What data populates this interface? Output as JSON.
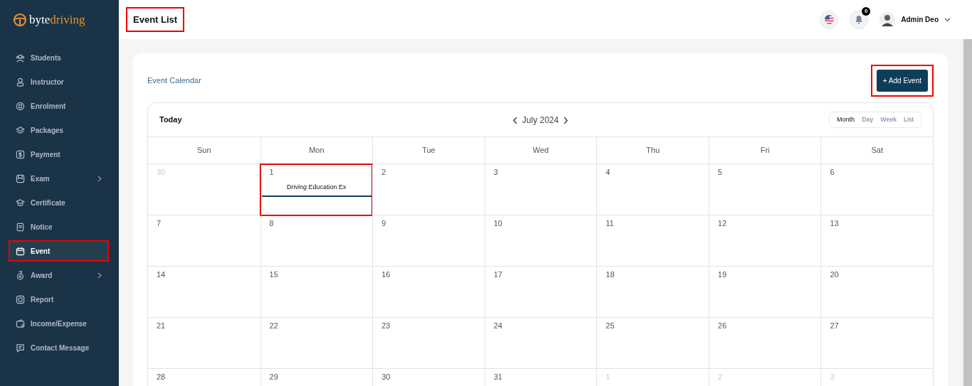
{
  "brand": {
    "part_1": "byte",
    "part_2": "driving"
  },
  "sidebar": {
    "items": [
      {
        "label": "Students",
        "has_submenu": false,
        "selected": false,
        "highlighted": false
      },
      {
        "label": "Instructor",
        "has_submenu": false,
        "selected": false,
        "highlighted": false
      },
      {
        "label": "Enrolment",
        "has_submenu": false,
        "selected": false,
        "highlighted": false
      },
      {
        "label": "Packages",
        "has_submenu": false,
        "selected": false,
        "highlighted": false
      },
      {
        "label": "Payment",
        "has_submenu": false,
        "selected": false,
        "highlighted": false
      },
      {
        "label": "Exam",
        "has_submenu": true,
        "selected": false,
        "highlighted": false
      },
      {
        "label": "Certificate",
        "has_submenu": false,
        "selected": false,
        "highlighted": false
      },
      {
        "label": "Notice",
        "has_submenu": false,
        "selected": false,
        "highlighted": false
      },
      {
        "label": "Event",
        "has_submenu": false,
        "selected": true,
        "highlighted": true
      },
      {
        "label": "Award",
        "has_submenu": true,
        "selected": false,
        "highlighted": false
      },
      {
        "label": "Report",
        "has_submenu": false,
        "selected": false,
        "highlighted": false
      },
      {
        "label": "Income/Expense",
        "has_submenu": false,
        "selected": false,
        "highlighted": false
      },
      {
        "label": "Contact Message",
        "has_submenu": false,
        "selected": false,
        "highlighted": false
      }
    ]
  },
  "header": {
    "title": "Event List",
    "title_highlighted": true,
    "notification_count": "0",
    "user_name": "Admin Deo"
  },
  "panel": {
    "title": "Event Calendar",
    "add_button": {
      "label": "+ Add Event",
      "highlighted": true
    }
  },
  "calendar": {
    "today_button": "Today",
    "month_label": "July 2024",
    "views": [
      {
        "label": "Month",
        "selected": true
      },
      {
        "label": "Day",
        "selected": false
      },
      {
        "label": "Week",
        "selected": false
      },
      {
        "label": "List",
        "selected": false
      }
    ],
    "weekdays": [
      "Sun",
      "Mon",
      "Tue",
      "Wed",
      "Thu",
      "Fri",
      "Sat"
    ],
    "weeks": [
      {
        "days": [
          {
            "label": "30",
            "outside": true
          },
          {
            "label": "1",
            "outside": false,
            "events": [
              {
                "title": "Driving Education Ex",
                "highlighted": true
              }
            ]
          },
          {
            "label": "2",
            "outside": false
          },
          {
            "label": "3",
            "outside": false
          },
          {
            "label": "4",
            "outside": false
          },
          {
            "label": "5",
            "outside": false
          },
          {
            "label": "6",
            "outside": false
          }
        ]
      },
      {
        "days": [
          {
            "label": "7",
            "outside": false
          },
          {
            "label": "8",
            "outside": false
          },
          {
            "label": "9",
            "outside": false
          },
          {
            "label": "10",
            "outside": false
          },
          {
            "label": "11",
            "outside": false
          },
          {
            "label": "12",
            "outside": false
          },
          {
            "label": "13",
            "outside": false
          }
        ]
      },
      {
        "days": [
          {
            "label": "14",
            "outside": false
          },
          {
            "label": "15",
            "outside": false
          },
          {
            "label": "16",
            "outside": false
          },
          {
            "label": "17",
            "outside": false
          },
          {
            "label": "18",
            "outside": false
          },
          {
            "label": "19",
            "outside": false
          },
          {
            "label": "20",
            "outside": false
          }
        ]
      },
      {
        "days": [
          {
            "label": "21",
            "outside": false
          },
          {
            "label": "22",
            "outside": false
          },
          {
            "label": "23",
            "outside": false
          },
          {
            "label": "24",
            "outside": false
          },
          {
            "label": "25",
            "outside": false
          },
          {
            "label": "26",
            "outside": false
          },
          {
            "label": "27",
            "outside": false
          }
        ]
      },
      {
        "days": [
          {
            "label": "28",
            "outside": false
          },
          {
            "label": "29",
            "outside": false
          },
          {
            "label": "30",
            "outside": false
          },
          {
            "label": "31",
            "outside": false
          },
          {
            "label": "1",
            "outside": true
          },
          {
            "label": "2",
            "outside": true
          },
          {
            "label": "3",
            "outside": true
          }
        ]
      }
    ]
  }
}
